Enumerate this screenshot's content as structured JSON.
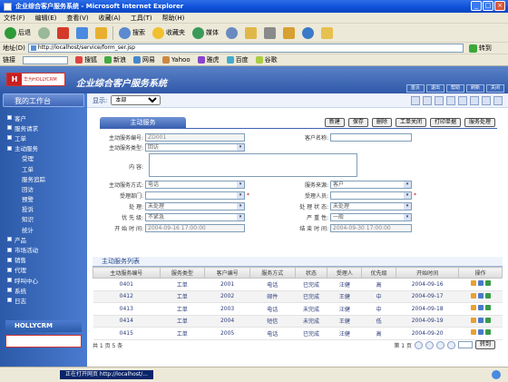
{
  "window": {
    "title": "企业综合客户服务系统 - Microsoft Internet Explorer"
  },
  "menu": [
    "文件(F)",
    "编辑(E)",
    "查看(V)",
    "收藏(A)",
    "工具(T)",
    "帮助(H)"
  ],
  "toolbar": {
    "back": "后退",
    "search": "搜索",
    "favorites": "收藏夹",
    "media": "媒体"
  },
  "address": {
    "label": "地址(D)",
    "url": "http://localhost/service/form_ser.jsp",
    "go": "转到"
  },
  "links": {
    "label": "链接",
    "items": [
      "搜狐",
      "新浪",
      "网易",
      "Yahoo",
      "雅虎",
      "百度",
      "谷歌"
    ]
  },
  "app": {
    "logo_text": "华为HOLLYCRM",
    "system_name": "企业综合客户服务系统",
    "top_buttons": [
      "首页",
      "退出",
      "帮助",
      "刷新",
      "关闭"
    ]
  },
  "sidebar": {
    "title": "我的工作台",
    "items": [
      {
        "label": "客户",
        "sub": false
      },
      {
        "label": "服务请求",
        "sub": false
      },
      {
        "label": "工单",
        "sub": false
      },
      {
        "label": "主动服务",
        "sub": false
      },
      {
        "label": "受理",
        "sub": true
      },
      {
        "label": "工单",
        "sub": true
      },
      {
        "label": "服务追踪",
        "sub": true
      },
      {
        "label": "回访",
        "sub": true
      },
      {
        "label": "预警",
        "sub": true
      },
      {
        "label": "投诉",
        "sub": true
      },
      {
        "label": "知识",
        "sub": true
      },
      {
        "label": "统计",
        "sub": true
      },
      {
        "label": "产品",
        "sub": false
      },
      {
        "label": "市场活动",
        "sub": false
      },
      {
        "label": "销售",
        "sub": false
      },
      {
        "label": "代理",
        "sub": false
      },
      {
        "label": "呼叫中心",
        "sub": false
      },
      {
        "label": "系统",
        "sub": false
      },
      {
        "label": "日志",
        "sub": false
      }
    ],
    "bottom_logo": "HOLLYCRM"
  },
  "main": {
    "display_label": "显示:",
    "display_value": "本部",
    "form_tab": "主动服务",
    "action_buttons": [
      "新建",
      "保存",
      "删除",
      "工单关闭",
      "打印单据",
      "服务处理"
    ],
    "form": {
      "field1": {
        "label": "主动服务编号:",
        "value": "ZD001"
      },
      "field2": {
        "label": "客户名称:",
        "value": ""
      },
      "field3": {
        "label": "主动服务类型:",
        "value": "回访"
      },
      "field4": {
        "label": "内 容:",
        "value": ""
      },
      "field5": {
        "label": "主动服务方式:",
        "value": "电话"
      },
      "field6": {
        "label": "服务来源:",
        "value": "客户"
      },
      "field7": {
        "label": "受理部门:",
        "value": ""
      },
      "field8": {
        "label": "受理人员:",
        "value": ""
      },
      "field9": {
        "label": "处 理:",
        "value": "未处理"
      },
      "field10": {
        "label": "处 理 状 态:",
        "value": "未处理"
      },
      "field11": {
        "label": "优 先 级:",
        "value": "不紧急"
      },
      "field12": {
        "label": "严 重 性:",
        "value": "一般"
      },
      "field13": {
        "label": "开 始 时 间:",
        "value": "2004-09-16 17:00:00"
      },
      "field14": {
        "label": "结 束 时 间:",
        "value": "2004-09-30 17:00:00"
      }
    },
    "grid": {
      "title": "主动服务列表",
      "columns": [
        "主动服务编号",
        "服务类型",
        "客户编号",
        "服务方式",
        "状态",
        "受理人",
        "优先级",
        "开始时间",
        "操作"
      ],
      "rows": [
        [
          "0401",
          "工单",
          "2001",
          "电话",
          "已完成",
          "汪健",
          "高",
          "2004-09-16",
          ""
        ],
        [
          "0412",
          "工单",
          "2002",
          "邮件",
          "已完成",
          "王健",
          "中",
          "2004-09-17",
          ""
        ],
        [
          "0413",
          "工单",
          "2003",
          "电话",
          "未完成",
          "汪健",
          "中",
          "2004-09-18",
          ""
        ],
        [
          "0414",
          "工单",
          "2004",
          "短信",
          "未完成",
          "王健",
          "低",
          "2004-09-19",
          ""
        ],
        [
          "0415",
          "工单",
          "2005",
          "电话",
          "已完成",
          "汪健",
          "高",
          "2004-09-20",
          ""
        ]
      ]
    },
    "pager": {
      "total": "共 1 页 5 条",
      "page_text": "第 1 页",
      "go": "转到"
    }
  },
  "status": {
    "text": "正在打开网页 http://localhost/..."
  }
}
